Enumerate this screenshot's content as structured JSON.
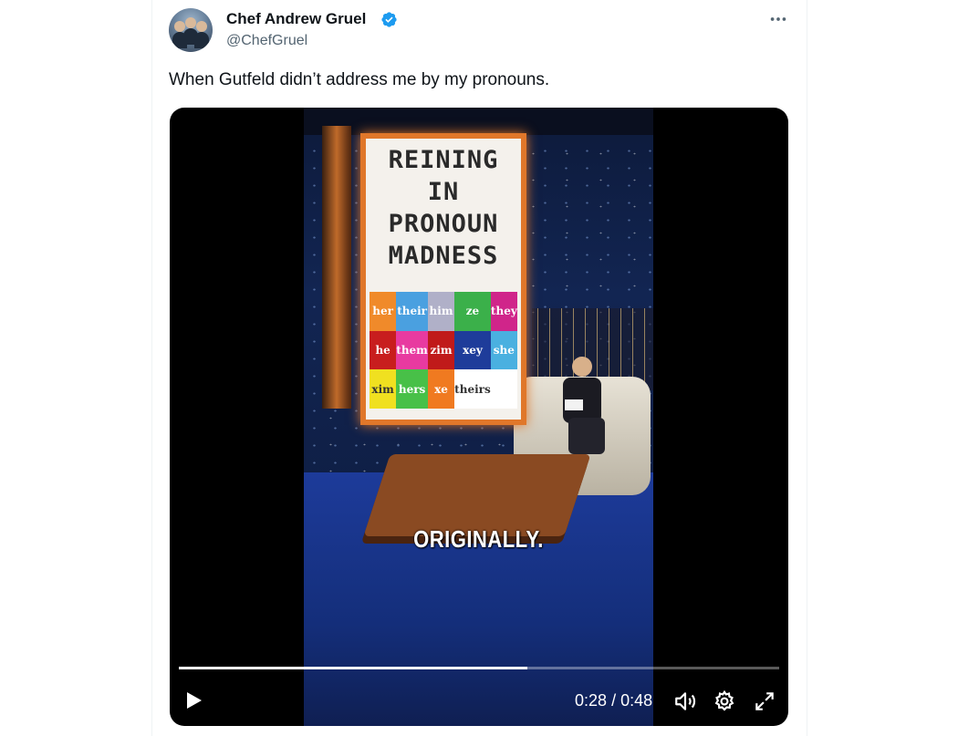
{
  "tweet": {
    "author_name": "Chef Andrew Gruel",
    "handle": "@ChefGruel",
    "text": "When Gutfeld didn’t address me by my pronouns.",
    "verified_color": "#1d9bf0"
  },
  "video": {
    "sign": {
      "title": [
        "REINING IN",
        "PRONOUN",
        "MADNESS"
      ],
      "cells": [
        {
          "text": "her",
          "color": "#f08a2a"
        },
        {
          "text": "their",
          "color": "#4aa0e0"
        },
        {
          "text": "him",
          "color": "#b0b0c8"
        },
        {
          "text": "ze",
          "color": "#3bb04a"
        },
        {
          "text": "they",
          "color": "#d0258a"
        },
        {
          "text": "he",
          "color": "#c81e1e"
        },
        {
          "text": "them",
          "color": "#e83aa0"
        },
        {
          "text": "zim",
          "color": "#c01a1a"
        },
        {
          "text": "xey",
          "color": "#1e3c9a"
        },
        {
          "text": "she",
          "color": "#4ab0e0"
        },
        {
          "text": "xim",
          "color": "#f0e020"
        },
        {
          "text": "hers",
          "color": "#48c048"
        },
        {
          "text": "xe",
          "color": "#f07a20"
        },
        {
          "text": "theirs",
          "color": "#ffffff"
        },
        {
          "text": "",
          "color": "#ffffff"
        }
      ]
    },
    "caption": "ORIGINALLY.",
    "current_time": "0:28",
    "separator": "/",
    "duration": "0:48",
    "progress_fraction": 0.58
  }
}
